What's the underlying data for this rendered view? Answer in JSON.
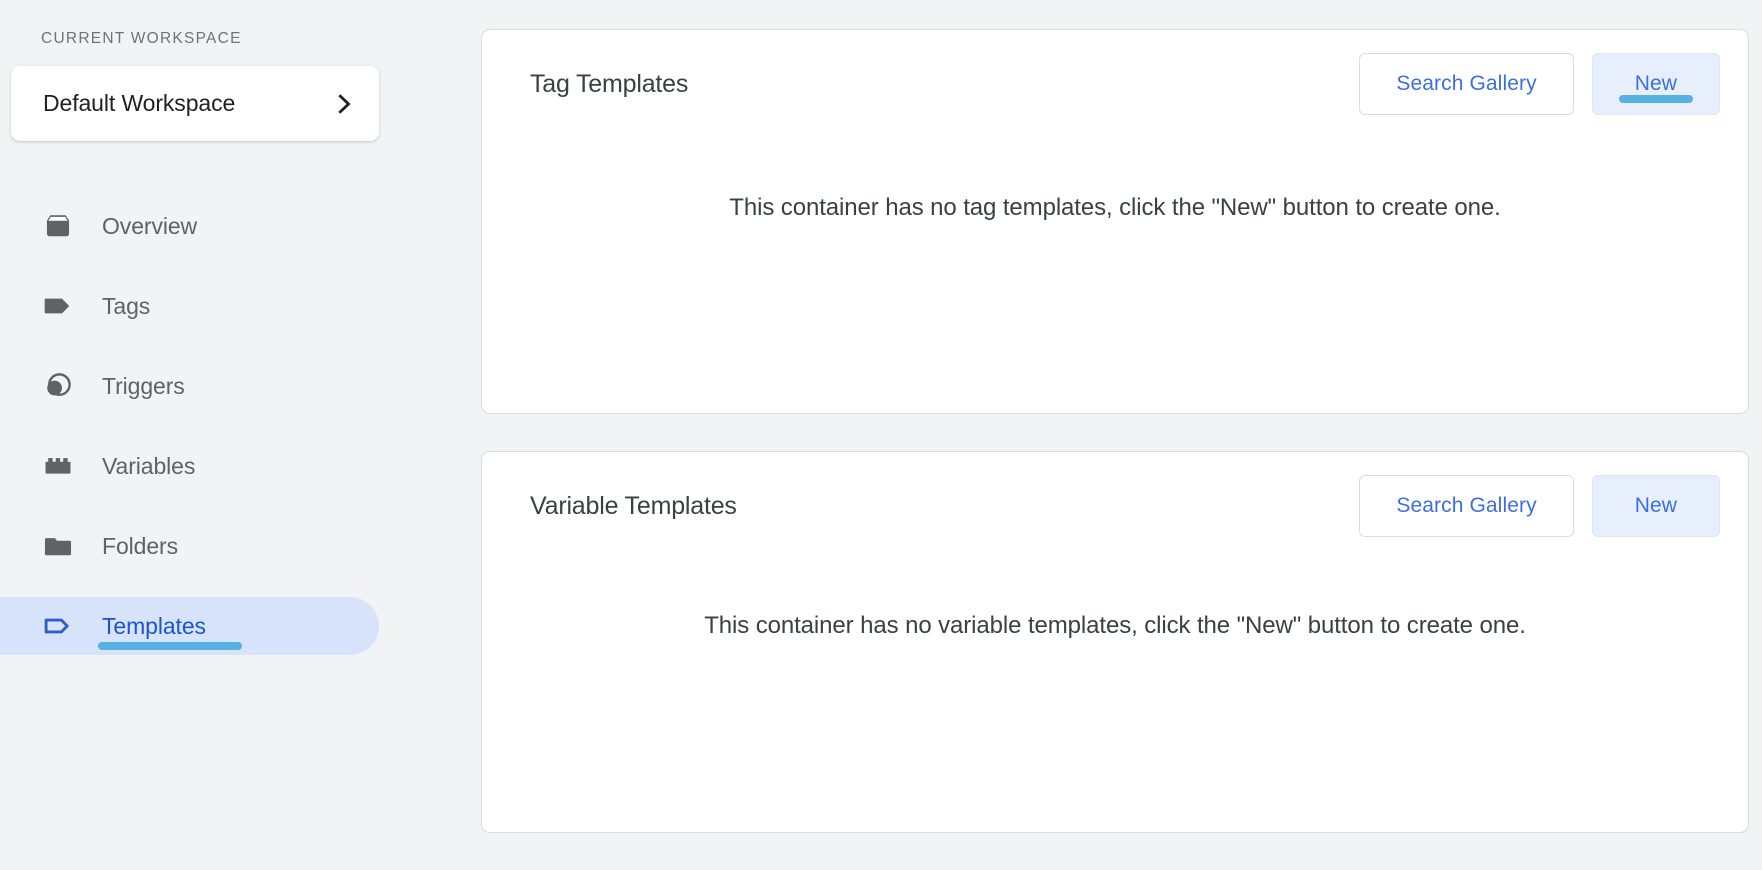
{
  "sidebar": {
    "workspace_label": "Current Workspace",
    "workspace_name": "Default Workspace",
    "workspace_chevron_icon": "chevron-right-icon",
    "items": [
      {
        "label": "Overview",
        "icon": "inbox-box-icon",
        "active": false
      },
      {
        "label": "Tags",
        "icon": "tag-filled-icon",
        "active": false
      },
      {
        "label": "Triggers",
        "icon": "trigger-circles-icon",
        "active": false
      },
      {
        "label": "Variables",
        "icon": "lego-brick-icon",
        "active": false
      },
      {
        "label": "Folders",
        "icon": "folder-icon",
        "active": false
      },
      {
        "label": "Templates",
        "icon": "tag-outline-icon",
        "active": true
      }
    ]
  },
  "main": {
    "cards": [
      {
        "title": "Tag Templates",
        "search_button": "Search Gallery",
        "new_button": "New",
        "new_button_highlighted": true,
        "empty_message": "This container has no tag templates, click the \"New\" button to create one."
      },
      {
        "title": "Variable Templates",
        "search_button": "Search Gallery",
        "new_button": "New",
        "new_button_highlighted": false,
        "empty_message": "This container has no variable templates, click the \"New\" button to create one."
      }
    ]
  },
  "colors": {
    "page_background": "#f1f3f4",
    "accent_blue": "#3d6fe0",
    "active_pill": "#d7e3fb",
    "active_text": "#1a57c8",
    "marker_highlight": "#4cadde",
    "icon_gray": "#5f6368",
    "card_border": "#dadce0"
  }
}
